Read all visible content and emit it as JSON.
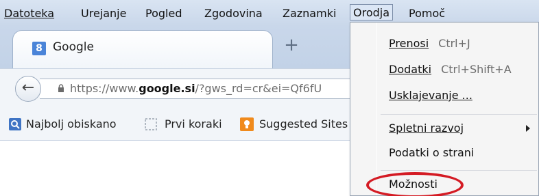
{
  "menubar": {
    "items": [
      {
        "label": "Datoteka",
        "mnemonic_index": 0
      },
      {
        "label": "Urejanje",
        "mnemonic_index": 3
      },
      {
        "label": "Pogled",
        "mnemonic_index": 0
      },
      {
        "label": "Zgodovina",
        "mnemonic_index": 6
      },
      {
        "label": "Zaznamki",
        "mnemonic_index": 0
      },
      {
        "label": "Orodja",
        "mnemonic_index": 1,
        "active": true
      },
      {
        "label": "Pomoč",
        "mnemonic_index": 3
      }
    ]
  },
  "tab": {
    "title": "Google",
    "favicon": "google-g-icon",
    "new_tab": "+"
  },
  "navbar": {
    "back_icon": "back-arrow-icon",
    "url_prefix": "https://www.",
    "url_domain": "google.si",
    "url_rest": "/?gws_rd=cr&ei=Qf6fU"
  },
  "bookmarks": [
    {
      "label": "Najbolj obiskano",
      "icon": "most-visited-icon"
    },
    {
      "label": "Prvi koraki",
      "icon": "dashed-page-icon"
    },
    {
      "label": "Suggested Sites",
      "icon": "suggested-sites-icon"
    }
  ],
  "dropdown": {
    "items": [
      {
        "label": "Prenosi",
        "shortcut": "Ctrl+J"
      },
      {
        "label": "Dodatki",
        "shortcut": "Ctrl+Shift+A"
      },
      {
        "label": "Usklajevanje ...",
        "shortcut": ""
      },
      {
        "label": "Spletni razvoj",
        "shortcut": "",
        "submenu": true
      },
      {
        "label": "Podatki o strani",
        "shortcut": ""
      },
      {
        "label": "Možnosti",
        "shortcut": "",
        "highlighted": true
      }
    ]
  },
  "colors": {
    "menubar_bg": "#d9e4f2",
    "highlight_red": "#d41b24",
    "favicon_blue": "#4a84d8"
  }
}
